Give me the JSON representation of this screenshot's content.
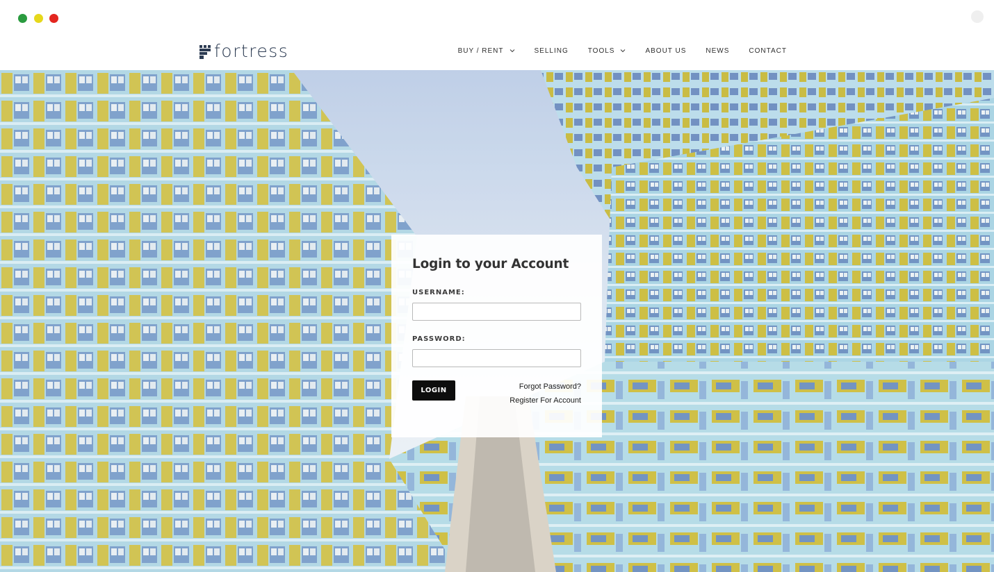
{
  "window": {
    "traffic_lights": {
      "green": "#2a9b3f",
      "yellow": "#e6d81b",
      "red": "#e3261f"
    }
  },
  "site": {
    "logo_text": "fortress",
    "brand_color": "#2c3b52"
  },
  "nav": {
    "items": [
      {
        "label": "BUY / RENT",
        "has_dropdown": true,
        "icon": "chevron-down-icon"
      },
      {
        "label": "SELLING",
        "has_dropdown": false
      },
      {
        "label": "TOOLS",
        "has_dropdown": true,
        "icon": "chevron-down-icon"
      },
      {
        "label": "ABOUT US",
        "has_dropdown": false
      },
      {
        "label": "NEWS",
        "has_dropdown": false
      },
      {
        "label": "CONTACT",
        "has_dropdown": false
      }
    ]
  },
  "login": {
    "title": "Login to your Account",
    "username_label": "USERNAME:",
    "username_value": "",
    "password_label": "PASSWORD:",
    "password_value": "",
    "submit_label": "LOGIN",
    "forgot_link": "Forgot Password?",
    "register_link": "Register For Account"
  },
  "hero": {
    "image": "low-angle view of high-rise residential towers with yellow and blue balconies against the sky",
    "colors": {
      "sky": "#cfdcec",
      "yellow": "#cbbc3c",
      "blue": "#9fcfe0",
      "tile": "#6f95c6"
    }
  }
}
